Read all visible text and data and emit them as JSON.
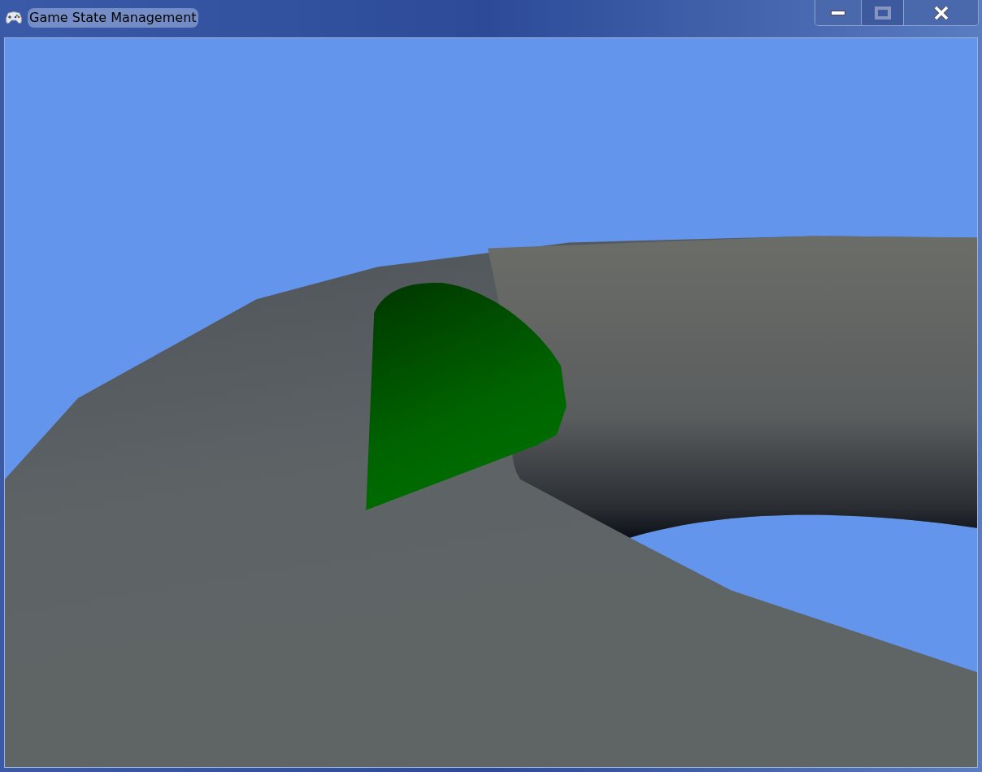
{
  "window": {
    "title": "Game State Management"
  },
  "buttons": [
    {
      "kind": "minimize",
      "disabled": false
    },
    {
      "kind": "maximize",
      "disabled": true
    },
    {
      "kind": "close",
      "disabled": false
    }
  ]
}
